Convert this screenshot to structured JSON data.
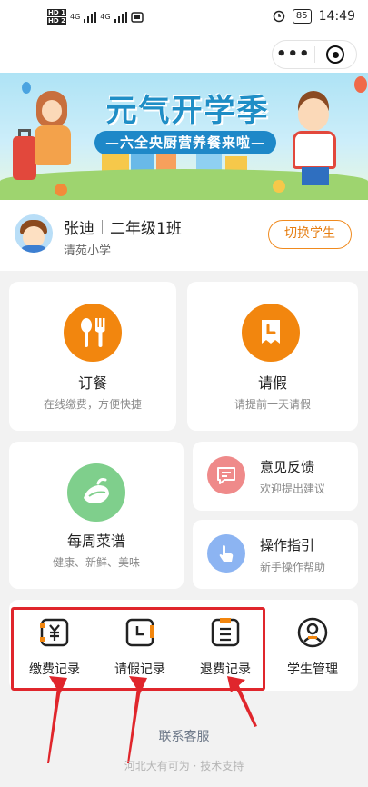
{
  "status_bar": {
    "tag1": "HD 1",
    "tag2": "HD 2",
    "signal1": "4G",
    "signal2": "4G",
    "battery": "85",
    "time": "14:49"
  },
  "banner": {
    "title": "元气开学季",
    "subtitle": "—六全央厨营养餐来啦—"
  },
  "user": {
    "name": "张迪",
    "grade": "二年级1班",
    "school": "清苑小学",
    "switch_label": "切换学生"
  },
  "cards": {
    "order": {
      "title": "订餐",
      "sub": "在线缴费，方便快捷",
      "icon": "utensils-icon"
    },
    "leave": {
      "title": "请假",
      "sub": "请提前一天请假",
      "icon": "leave-calendar-icon"
    },
    "menu": {
      "title": "每周菜谱",
      "sub": "健康、新鲜、美味",
      "icon": "vegetable-icon"
    },
    "feedback": {
      "title": "意见反馈",
      "sub": "欢迎提出建议",
      "icon": "feedback-icon"
    },
    "guide": {
      "title": "操作指引",
      "sub": "新手操作帮助",
      "icon": "pointer-hand-icon"
    }
  },
  "records": [
    {
      "label": "缴费记录",
      "icon": "payment-record-icon"
    },
    {
      "label": "请假记录",
      "icon": "leave-record-icon"
    },
    {
      "label": "退费记录",
      "icon": "refund-record-icon"
    },
    {
      "label": "学生管理",
      "icon": "student-manage-icon"
    }
  ],
  "contact": "联系客服",
  "footer": "河北大有可为 · 技术支持",
  "colors": {
    "accent": "#f2860e",
    "menu_green": "#7fcf8c",
    "feedback_red": "#ef8a8a",
    "guide_blue": "#8cb4f2",
    "highlight_red": "#e0262c"
  }
}
